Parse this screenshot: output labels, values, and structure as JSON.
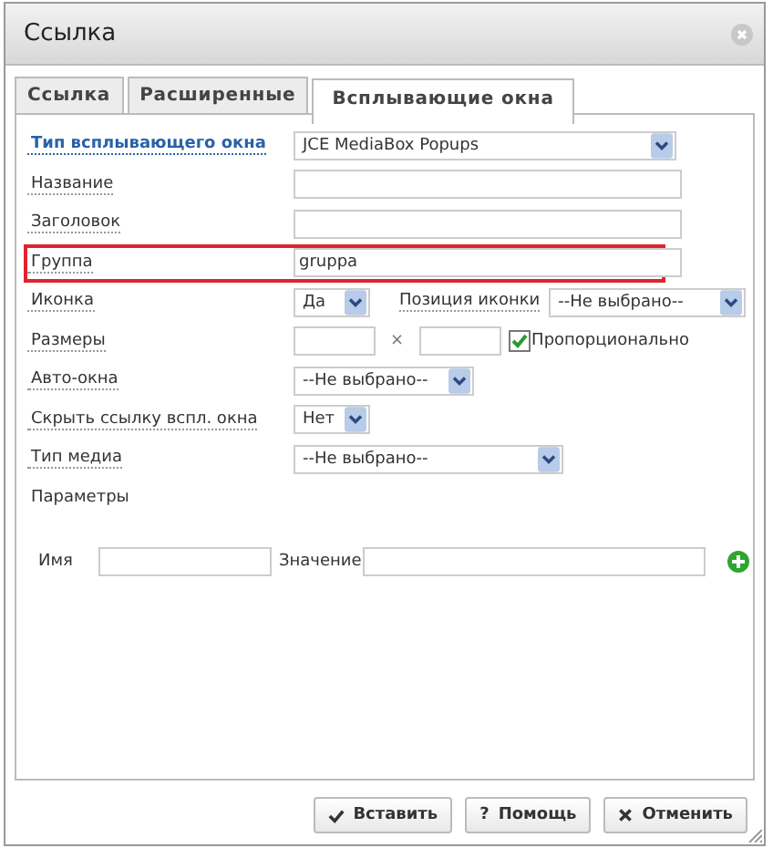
{
  "window": {
    "title": "Ссылка"
  },
  "tabs": [
    {
      "label": "Ссылка",
      "selected": false
    },
    {
      "label": "Расширенные",
      "selected": false
    },
    {
      "label": "Всплывающие окна",
      "selected": true
    }
  ],
  "rows": [
    {
      "label": "Тип всплывающего окна",
      "kind": "link",
      "highlighted": false,
      "controls": [
        {
          "kind": "select",
          "value": "JCE MediaBox Popups"
        }
      ]
    },
    {
      "label": "Название",
      "kind": "plain",
      "highlighted": false,
      "controls": [
        {
          "kind": "text"
        }
      ]
    },
    {
      "label": "Заголовок",
      "kind": "plain",
      "highlighted": false,
      "controls": [
        {
          "kind": "text"
        }
      ]
    },
    {
      "label": "Группа",
      "kind": "plain",
      "highlighted": true,
      "controls": [
        {
          "kind": "text",
          "value": "gruppa"
        }
      ]
    },
    {
      "label": "Иконка",
      "kind": "plain",
      "highlighted": false,
      "controls": [
        {
          "kind": "select",
          "value": "Да"
        },
        {
          "kind": "label",
          "text": "Позиция иконки"
        },
        {
          "kind": "select",
          "value": "--Не выбрано--"
        }
      ]
    },
    {
      "label": "Размеры",
      "kind": "plain",
      "highlighted": false,
      "controls": [
        {
          "kind": "text"
        },
        {
          "kind": "sign",
          "text": "×"
        },
        {
          "kind": "text"
        },
        {
          "kind": "checkbox",
          "checked": true,
          "text": "Пропорционально"
        }
      ]
    },
    {
      "label": "Авто-окна",
      "kind": "plain",
      "highlighted": false,
      "controls": [
        {
          "kind": "select",
          "value": "--Не выбрано--"
        }
      ]
    },
    {
      "label": "Скрыть ссылку вспл. окна",
      "kind": "plain",
      "highlighted": false,
      "controls": [
        {
          "kind": "select",
          "value": "Нет"
        }
      ]
    },
    {
      "label": "Тип медиа",
      "kind": "plain",
      "highlighted": false,
      "controls": [
        {
          "kind": "select",
          "value": "--Не выбрано--"
        }
      ]
    },
    {
      "label": "Параметры",
      "kind": "heading",
      "highlighted": false,
      "controls": []
    }
  ],
  "parameters": {
    "name_label": "Имя",
    "value_label": "Значение"
  },
  "buttons": [
    {
      "kind": "insert",
      "label": "Вставить"
    },
    {
      "kind": "help",
      "label": "Помощь",
      "icon": "?"
    },
    {
      "kind": "cancel",
      "label": "Отменить"
    }
  ]
}
